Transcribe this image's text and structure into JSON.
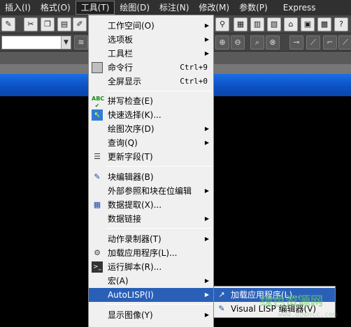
{
  "menubar": {
    "items": [
      "插入(I)",
      "格式(O)",
      "工具(T)",
      "绘图(D)",
      "标注(N)",
      "修改(M)",
      "参数(P)",
      "Express"
    ]
  },
  "tools_menu": {
    "items": [
      {
        "label": "工作空间(O)",
        "submenu": true
      },
      {
        "label": "选项板",
        "submenu": true
      },
      {
        "label": "工具栏",
        "submenu": true
      },
      {
        "label": "命令行",
        "shortcut": "Ctrl+9",
        "icon": "command-line-icon"
      },
      {
        "label": "全屏显示",
        "shortcut": "Ctrl+0"
      },
      {
        "label": "拼写检查(E)",
        "icon": "spell-check-icon"
      },
      {
        "label": "快速选择(K)...",
        "icon": "quick-select-icon"
      },
      {
        "label": "绘图次序(D)",
        "submenu": true
      },
      {
        "label": "查询(Q)",
        "submenu": true
      },
      {
        "label": "更新字段(T)",
        "icon": "update-field-icon"
      },
      {
        "label": "块编辑器(B)",
        "icon": "block-editor-icon"
      },
      {
        "label": "外部参照和块在位编辑",
        "submenu": true
      },
      {
        "label": "数据提取(X)...",
        "icon": "data-extraction-icon"
      },
      {
        "label": "数据链接",
        "submenu": true
      },
      {
        "label": "动作录制器(T)",
        "submenu": true
      },
      {
        "label": "加载应用程序(L)...",
        "icon": "load-application-icon"
      },
      {
        "label": "运行脚本(R)...",
        "icon": "run-script-icon"
      },
      {
        "label": "宏(A)",
        "submenu": true
      },
      {
        "label": "AutoLISP(I)",
        "submenu": true,
        "highlighted": true
      },
      {
        "label": "显示图像(Y)",
        "submenu": true
      }
    ]
  },
  "autolisp_submenu": {
    "items": [
      {
        "label": "加载应用程序(L)...",
        "icon": "load-application-icon",
        "highlighted": true
      },
      {
        "label": "Visual LISP 编辑器(V)",
        "icon": "visual-lisp-icon"
      }
    ]
  },
  "watermark": {
    "text": "绿色资源网",
    "url": "www.downcc.com"
  },
  "colors": {
    "highlight": "#2a5fb8",
    "menu_bg": "#f0f0f0",
    "menubar_bg": "#303030",
    "blue_bar": "#1c6ee6"
  }
}
